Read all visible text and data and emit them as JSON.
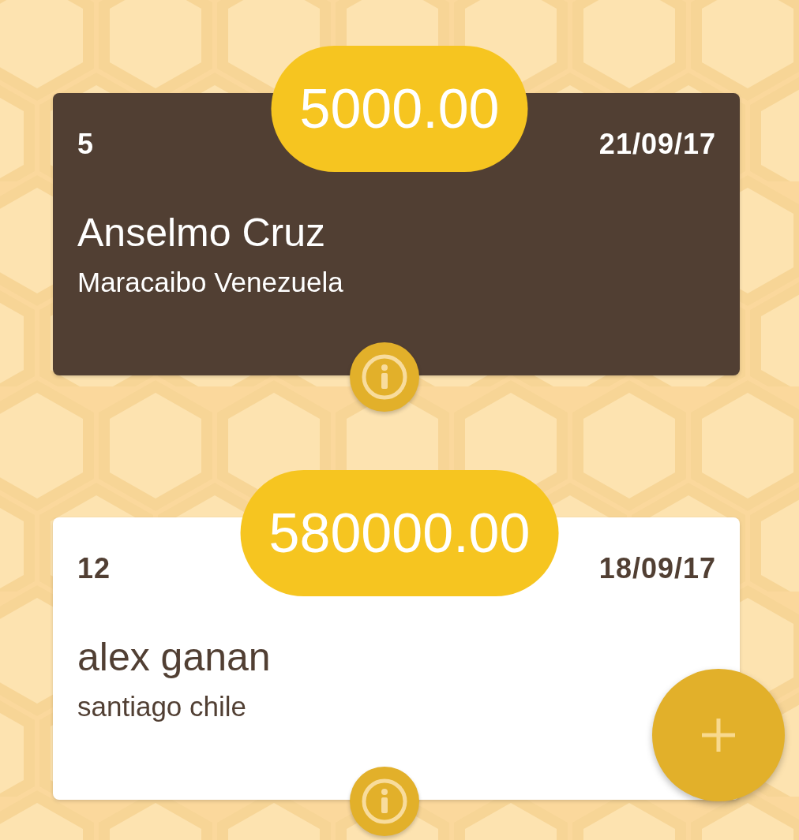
{
  "orders": [
    {
      "number": "5",
      "date": "21/09/17",
      "amount": "5000.00",
      "name": "Anselmo Cruz",
      "location": "Maracaibo Venezuela",
      "selected": true
    },
    {
      "number": "12",
      "date": "18/09/17",
      "amount": "580000.00",
      "name": "alex ganan",
      "location": "santiago chile",
      "selected": false
    }
  ]
}
